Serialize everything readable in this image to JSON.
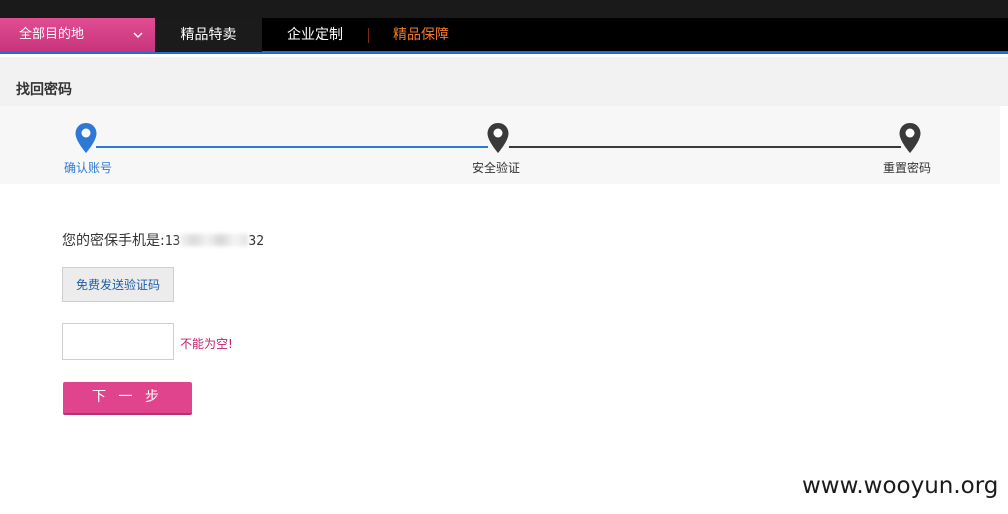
{
  "nav": {
    "destination": "全部目的地",
    "items": [
      "精品特卖",
      "企业定制",
      "精品保障"
    ]
  },
  "page_title": "找回密码",
  "steps": [
    {
      "label": "确认账号",
      "active": true
    },
    {
      "label": "安全验证",
      "active": false
    },
    {
      "label": "重置密码",
      "active": false
    }
  ],
  "form": {
    "phone_prefix_label": "您的密保手机是:",
    "phone_start": "13",
    "phone_end": "32",
    "send_code_label": "免费发送验证码",
    "code_value": "",
    "error_text": "不能为空!",
    "next_label": "下 一 步"
  },
  "watermark": "www.wooyun.org",
  "colors": {
    "accent_pink": "#e0448d",
    "accent_blue": "#2d7ad6",
    "nav_highlight": "#f07a2a"
  },
  "icons": {
    "dropdown": "chevron-down-icon",
    "step_marker": "map-pin-icon"
  }
}
